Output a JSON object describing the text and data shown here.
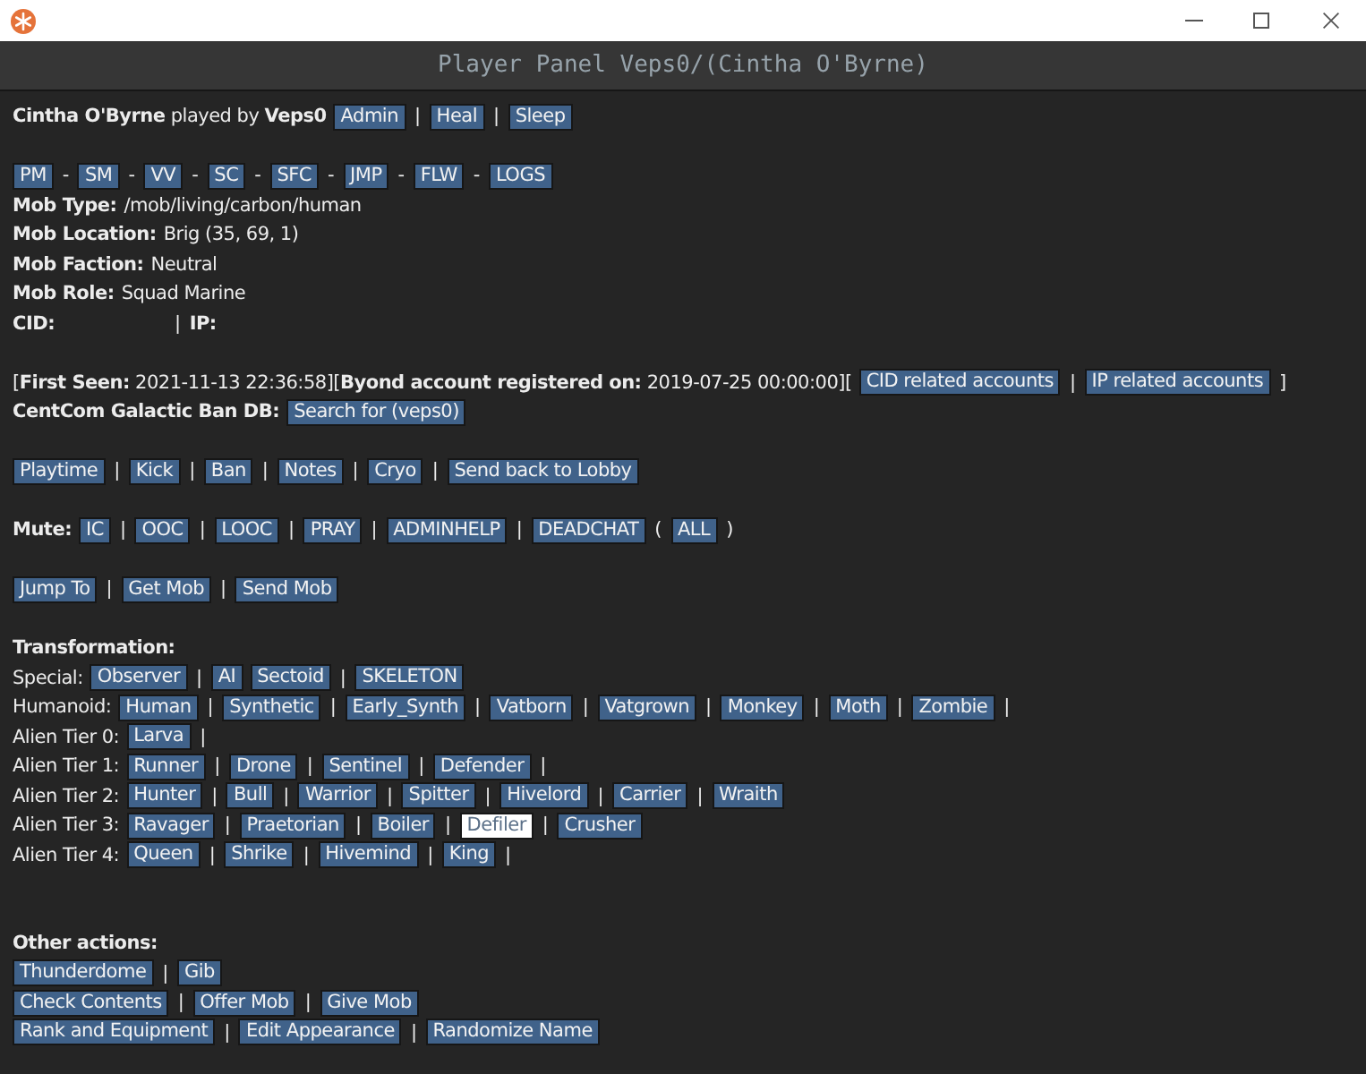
{
  "header": {
    "title": "Player Panel Veps0/(Cintha O'Byrne)"
  },
  "sections": [
    {
      "lines": [
        {
          "parts": [
            {
              "kind": "text",
              "text": "**Cintha O'Byrne** played by **Veps0**"
            },
            {
              "kind": "button",
              "text": "Admin"
            },
            {
              "kind": "sep",
              "text": "|"
            },
            {
              "kind": "button",
              "text": "Heal"
            },
            {
              "kind": "sep",
              "text": "|"
            },
            {
              "kind": "button",
              "text": "Sleep"
            }
          ]
        }
      ]
    },
    {
      "lines": [
        {
          "parts": [
            {
              "kind": "button",
              "text": "PM"
            },
            {
              "kind": "sep",
              "text": "-"
            },
            {
              "kind": "button",
              "text": "SM"
            },
            {
              "kind": "sep",
              "text": "-"
            },
            {
              "kind": "button",
              "text": "VV"
            },
            {
              "kind": "sep",
              "text": "-"
            },
            {
              "kind": "button",
              "text": "SC"
            },
            {
              "kind": "sep",
              "text": "-"
            },
            {
              "kind": "button",
              "text": "SFC"
            },
            {
              "kind": "sep",
              "text": "-"
            },
            {
              "kind": "button",
              "text": "JMP"
            },
            {
              "kind": "sep",
              "text": "-"
            },
            {
              "kind": "button",
              "text": "FLW"
            },
            {
              "kind": "sep",
              "text": "-"
            },
            {
              "kind": "button",
              "text": "LOGS"
            }
          ]
        },
        {
          "parts": [
            {
              "kind": "field",
              "label": "Mob Type:",
              "value": "/mob/living/carbon/human"
            }
          ]
        },
        {
          "parts": [
            {
              "kind": "field",
              "label": "Mob Location:",
              "value": "Brig (35, 69, 1)"
            }
          ]
        },
        {
          "parts": [
            {
              "kind": "field",
              "label": "Mob Faction:",
              "value": "Neutral"
            }
          ]
        },
        {
          "parts": [
            {
              "kind": "field",
              "label": "Mob Role:",
              "value": "Squad Marine"
            }
          ]
        },
        {
          "parts": [
            {
              "kind": "field",
              "label": "CID:"
            },
            {
              "kind": "sep",
              "text": "|"
            },
            {
              "kind": "field",
              "label": "IP:"
            }
          ]
        }
      ]
    },
    {
      "lines": [
        {
          "parts": [
            {
              "kind": "text",
              "text": "[**First Seen:** 2021-11-13 22:36:58][**Byond account registered on:** 2019-07-25 00:00:00]["
            },
            {
              "kind": "button",
              "text": "CID related accounts"
            },
            {
              "kind": "sep",
              "text": "|"
            },
            {
              "kind": "button",
              "text": "IP related accounts"
            },
            {
              "kind": "sep",
              "text": "]"
            }
          ]
        },
        {
          "parts": [
            {
              "kind": "label",
              "text": "CentCom Galactic Ban DB:"
            },
            {
              "kind": "button",
              "text": "Search for (veps0)"
            }
          ]
        }
      ]
    },
    {
      "lines": [
        {
          "parts": [
            {
              "kind": "button",
              "text": "Playtime"
            },
            {
              "kind": "sep",
              "text": "|"
            },
            {
              "kind": "button",
              "text": "Kick"
            },
            {
              "kind": "sep",
              "text": "|"
            },
            {
              "kind": "button",
              "text": "Ban"
            },
            {
              "kind": "sep",
              "text": "|"
            },
            {
              "kind": "button",
              "text": "Notes"
            },
            {
              "kind": "sep",
              "text": "|"
            },
            {
              "kind": "button",
              "text": "Cryo"
            },
            {
              "kind": "sep",
              "text": "|"
            },
            {
              "kind": "button",
              "text": "Send back to Lobby"
            }
          ]
        }
      ]
    },
    {
      "lines": [
        {
          "parts": [
            {
              "kind": "label",
              "text": "Mute:"
            },
            {
              "kind": "button",
              "text": "IC"
            },
            {
              "kind": "sep",
              "text": "|"
            },
            {
              "kind": "button",
              "text": "OOC"
            },
            {
              "kind": "sep",
              "text": "|"
            },
            {
              "kind": "button",
              "text": "LOOC"
            },
            {
              "kind": "sep",
              "text": "|"
            },
            {
              "kind": "button",
              "text": "PRAY"
            },
            {
              "kind": "sep",
              "text": "|"
            },
            {
              "kind": "button",
              "text": "ADMINHELP"
            },
            {
              "kind": "sep",
              "text": "|"
            },
            {
              "kind": "button",
              "text": "DEADCHAT"
            },
            {
              "kind": "sep",
              "text": "("
            },
            {
              "kind": "button",
              "text": "ALL"
            },
            {
              "kind": "sep",
              "text": ")"
            }
          ]
        }
      ]
    },
    {
      "lines": [
        {
          "parts": [
            {
              "kind": "button",
              "text": "Jump To"
            },
            {
              "kind": "sep",
              "text": "|"
            },
            {
              "kind": "button",
              "text": "Get Mob"
            },
            {
              "kind": "sep",
              "text": "|"
            },
            {
              "kind": "button",
              "text": "Send Mob"
            }
          ]
        }
      ]
    },
    {
      "heading": "Transformation:",
      "lines": [
        {
          "parts": [
            {
              "kind": "text",
              "text": "Special:"
            },
            {
              "kind": "button",
              "text": "Observer",
              "selected": false
            },
            {
              "kind": "sep",
              "text": "|"
            },
            {
              "kind": "button",
              "text": "AI",
              "selected": false
            },
            {
              "kind": "button",
              "text": "Sectoid",
              "selected": false
            },
            {
              "kind": "sep",
              "text": "|"
            },
            {
              "kind": "button",
              "text": "SKELETON",
              "selected": false
            }
          ]
        },
        {
          "parts": [
            {
              "kind": "text",
              "text": "Humanoid:"
            },
            {
              "kind": "button",
              "text": "Human",
              "selected": false
            },
            {
              "kind": "sep",
              "text": "|"
            },
            {
              "kind": "button",
              "text": "Synthetic",
              "selected": false
            },
            {
              "kind": "sep",
              "text": "|"
            },
            {
              "kind": "button",
              "text": "Early_Synth",
              "selected": false
            },
            {
              "kind": "sep",
              "text": "|"
            },
            {
              "kind": "button",
              "text": "Vatborn",
              "selected": false
            },
            {
              "kind": "sep",
              "text": "|"
            },
            {
              "kind": "button",
              "text": "Vatgrown",
              "selected": false
            },
            {
              "kind": "sep",
              "text": "|"
            },
            {
              "kind": "button",
              "text": "Monkey",
              "selected": false
            },
            {
              "kind": "sep",
              "text": "|"
            },
            {
              "kind": "button",
              "text": "Moth",
              "selected": false
            },
            {
              "kind": "sep",
              "text": "|"
            },
            {
              "kind": "button",
              "text": "Zombie",
              "selected": false
            },
            {
              "kind": "sep",
              "text": "|"
            }
          ]
        },
        {
          "parts": [
            {
              "kind": "text",
              "text": "Alien Tier 0:"
            },
            {
              "kind": "button",
              "text": "Larva",
              "selected": false
            },
            {
              "kind": "sep",
              "text": "|"
            }
          ]
        },
        {
          "parts": [
            {
              "kind": "text",
              "text": "Alien Tier 1:"
            },
            {
              "kind": "button",
              "text": "Runner",
              "selected": false
            },
            {
              "kind": "sep",
              "text": "|"
            },
            {
              "kind": "button",
              "text": "Drone",
              "selected": false
            },
            {
              "kind": "sep",
              "text": "|"
            },
            {
              "kind": "button",
              "text": "Sentinel",
              "selected": false
            },
            {
              "kind": "sep",
              "text": "|"
            },
            {
              "kind": "button",
              "text": "Defender",
              "selected": false
            },
            {
              "kind": "sep",
              "text": "|"
            }
          ]
        },
        {
          "parts": [
            {
              "kind": "text",
              "text": "Alien Tier 2:"
            },
            {
              "kind": "button",
              "text": "Hunter",
              "selected": false
            },
            {
              "kind": "sep",
              "text": "|"
            },
            {
              "kind": "button",
              "text": "Bull",
              "selected": false
            },
            {
              "kind": "sep",
              "text": "|"
            },
            {
              "kind": "button",
              "text": "Warrior",
              "selected": false
            },
            {
              "kind": "sep",
              "text": "|"
            },
            {
              "kind": "button",
              "text": "Spitter",
              "selected": false
            },
            {
              "kind": "sep",
              "text": "|"
            },
            {
              "kind": "button",
              "text": "Hivelord",
              "selected": false
            },
            {
              "kind": "sep",
              "text": "|"
            },
            {
              "kind": "button",
              "text": "Carrier",
              "selected": false
            },
            {
              "kind": "sep",
              "text": "|"
            },
            {
              "kind": "button",
              "text": "Wraith",
              "selected": false
            }
          ]
        },
        {
          "parts": [
            {
              "kind": "text",
              "text": "Alien Tier 3:"
            },
            {
              "kind": "button",
              "text": "Ravager",
              "selected": false
            },
            {
              "kind": "sep",
              "text": "|"
            },
            {
              "kind": "button",
              "text": "Praetorian",
              "selected": false
            },
            {
              "kind": "sep",
              "text": "|"
            },
            {
              "kind": "button",
              "text": "Boiler",
              "selected": false
            },
            {
              "kind": "sep",
              "text": "|"
            },
            {
              "kind": "button",
              "text": "Defiler",
              "selected": true
            },
            {
              "kind": "sep",
              "text": "|"
            },
            {
              "kind": "button",
              "text": "Crusher",
              "selected": false
            }
          ]
        },
        {
          "parts": [
            {
              "kind": "text",
              "text": "Alien Tier 4:"
            },
            {
              "kind": "button",
              "text": "Queen",
              "selected": false
            },
            {
              "kind": "sep",
              "text": "|"
            },
            {
              "kind": "button",
              "text": "Shrike",
              "selected": false
            },
            {
              "kind": "sep",
              "text": "|"
            },
            {
              "kind": "button",
              "text": "Hivemind",
              "selected": false
            },
            {
              "kind": "sep",
              "text": "|"
            },
            {
              "kind": "button",
              "text": "King",
              "selected": false
            },
            {
              "kind": "sep",
              "text": "|"
            }
          ]
        }
      ]
    },
    {
      "heading": "Other actions:",
      "lines": [
        {
          "parts": [
            {
              "kind": "button",
              "text": "Thunderdome"
            },
            {
              "kind": "sep",
              "text": "|"
            },
            {
              "kind": "button",
              "text": "Gib"
            }
          ]
        },
        {
          "parts": [
            {
              "kind": "button",
              "text": "Check Contents"
            },
            {
              "kind": "sep",
              "text": "|"
            },
            {
              "kind": "button",
              "text": "Offer Mob"
            },
            {
              "kind": "sep",
              "text": "|"
            },
            {
              "kind": "button",
              "text": "Give Mob"
            }
          ]
        },
        {
          "parts": [
            {
              "kind": "button",
              "text": "Rank and Equipment"
            },
            {
              "kind": "sep",
              "text": "|"
            },
            {
              "kind": "button",
              "text": "Edit Appearance"
            },
            {
              "kind": "sep",
              "text": "|"
            },
            {
              "kind": "button",
              "text": "Randomize Name"
            }
          ]
        }
      ]
    }
  ]
}
